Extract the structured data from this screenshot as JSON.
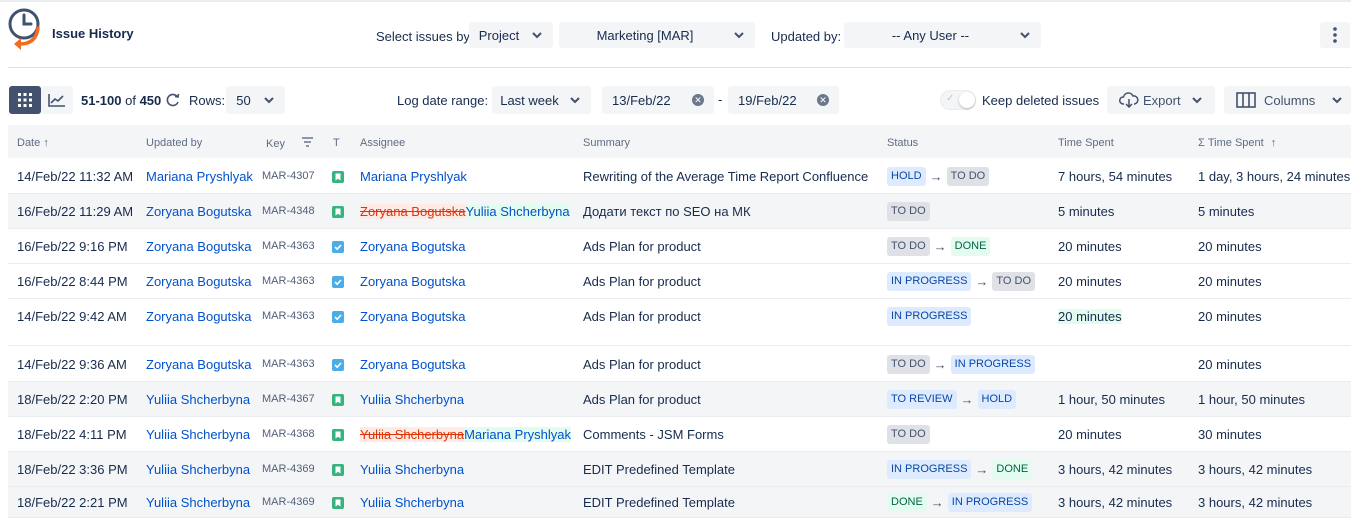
{
  "app": {
    "title": "Issue History"
  },
  "filters": {
    "select_label": "Select issues by:",
    "select_value": "Project",
    "project_value": "Marketing [MAR]",
    "updated_by_label": "Updated by:",
    "updated_by_value": "-- Any User --"
  },
  "toolbar": {
    "range_start": "51-100",
    "range_of": "of",
    "total": "450",
    "rows_label": "Rows:",
    "rows_value": "50",
    "log_range_label": "Log date range:",
    "log_range_value": "Last week",
    "date_from": "13/Feb/22",
    "date_sep": "-",
    "date_to": "19/Feb/22",
    "keep_deleted_label": "Keep deleted issues",
    "export_label": "Export",
    "columns_label": "Columns"
  },
  "table": {
    "headers": {
      "date": "Date",
      "updated_by": "Updated by",
      "key": "Key",
      "type": "T",
      "assignee": "Assignee",
      "summary": "Summary",
      "status": "Status",
      "time_spent": "Time Spent",
      "sum_time_spent": "Σ Time Spent"
    },
    "rows": [
      {
        "date": "14/Feb/22 11:32 AM",
        "updated_by": "Mariana Pryshlyak",
        "key": "MAR-4307",
        "type": "story",
        "assignee_old": "",
        "assignee": "Mariana Pryshlyak",
        "summary": "Rewriting of the Average Time Report Confluence",
        "status_from": "HOLD",
        "status_to": "TO DO",
        "time_spent": "7 hours, 54 minutes",
        "sum_time_spent": "1 day, 3 hours, 24 minutes"
      },
      {
        "date": "16/Feb/22 11:29 AM",
        "updated_by": "Zoryana Bogutska",
        "key": "MAR-4348",
        "type": "story",
        "assignee_old": "Zoryana Bogutska",
        "assignee": "Yuliia Shcherbyna",
        "summary": "Додати текст по SEO на МК",
        "status_from": "",
        "status_to": "TO DO",
        "time_spent": "5 minutes",
        "sum_time_spent": "5 minutes"
      },
      {
        "date": "16/Feb/22 9:16 PM",
        "updated_by": "Zoryana Bogutska",
        "key": "MAR-4363",
        "type": "task",
        "assignee_old": "",
        "assignee": "Zoryana Bogutska",
        "summary": "Ads Plan for product",
        "status_from": "TO DO",
        "status_to": "DONE",
        "time_spent": "20 minutes",
        "sum_time_spent": "20 minutes"
      },
      {
        "date": "16/Feb/22 8:44 PM",
        "updated_by": "Zoryana Bogutska",
        "key": "MAR-4363",
        "type": "task",
        "assignee_old": "",
        "assignee": "Zoryana Bogutska",
        "summary": "Ads Plan for product",
        "status_from": "IN PROGRESS",
        "status_to": "TO DO",
        "time_spent": "20 minutes",
        "sum_time_spent": "20 minutes"
      },
      {
        "date": "14/Feb/22 9:42 AM",
        "updated_by": "Zoryana Bogutska",
        "key": "MAR-4363",
        "type": "task",
        "assignee_old": "",
        "assignee": "Zoryana Bogutska",
        "summary": "Ads Plan for product",
        "status_from": "",
        "status_to": "IN PROGRESS",
        "time_spent": "20 minutes",
        "sum_time_spent": "20 minutes"
      },
      {
        "date": "14/Feb/22 9:36 AM",
        "updated_by": "Zoryana Bogutska",
        "key": "MAR-4363",
        "type": "task",
        "assignee_old": "",
        "assignee": "Zoryana Bogutska",
        "summary": "Ads Plan for product",
        "status_from": "TO DO",
        "status_to": "IN PROGRESS",
        "time_spent": "",
        "sum_time_spent": "20 minutes"
      },
      {
        "date": "18/Feb/22 2:20 PM",
        "updated_by": "Yuliia Shcherbyna",
        "key": "MAR-4367",
        "type": "story",
        "assignee_old": "",
        "assignee": "Yuliia Shcherbyna",
        "summary": "Ads Plan for product",
        "status_from": "TO REVIEW",
        "status_to": "HOLD",
        "time_spent": "1 hour, 50 minutes",
        "sum_time_spent": "1 hour, 50 minutes"
      },
      {
        "date": "18/Feb/22 4:11 PM",
        "updated_by": "Yuliia Shcherbyna",
        "key": "MAR-4368",
        "type": "story",
        "assignee_old": "Yuliia Shcherbyna",
        "assignee": "Mariana Pryshlyak",
        "summary": "Comments - JSM Forms",
        "status_from": "",
        "status_to": "TO DO",
        "time_spent": "20 minutes",
        "sum_time_spent": "30 minutes"
      },
      {
        "date": "18/Feb/22 3:36 PM",
        "updated_by": "Yuliia Shcherbyna",
        "key": "MAR-4369",
        "type": "story",
        "assignee_old": "",
        "assignee": "Yuliia Shcherbyna",
        "summary": "EDIT Predefined Template",
        "status_from": "IN PROGRESS",
        "status_to": "DONE",
        "time_spent": "3 hours, 42 minutes",
        "sum_time_spent": "3 hours, 42 minutes"
      },
      {
        "date": "18/Feb/22 2:21 PM",
        "updated_by": "Yuliia Shcherbyna",
        "key": "MAR-4369",
        "type": "story",
        "assignee_old": "",
        "assignee": "Yuliia Shcherbyna",
        "summary": "EDIT Predefined Template",
        "status_from": "DONE",
        "status_to": "IN PROGRESS",
        "time_spent": "3 hours, 42 minutes",
        "sum_time_spent": "3 hours, 42 minutes"
      }
    ]
  },
  "colors": {
    "accent": "#0052cc",
    "logo_orange": "#f26b21",
    "logo_blue": "#42526e"
  }
}
